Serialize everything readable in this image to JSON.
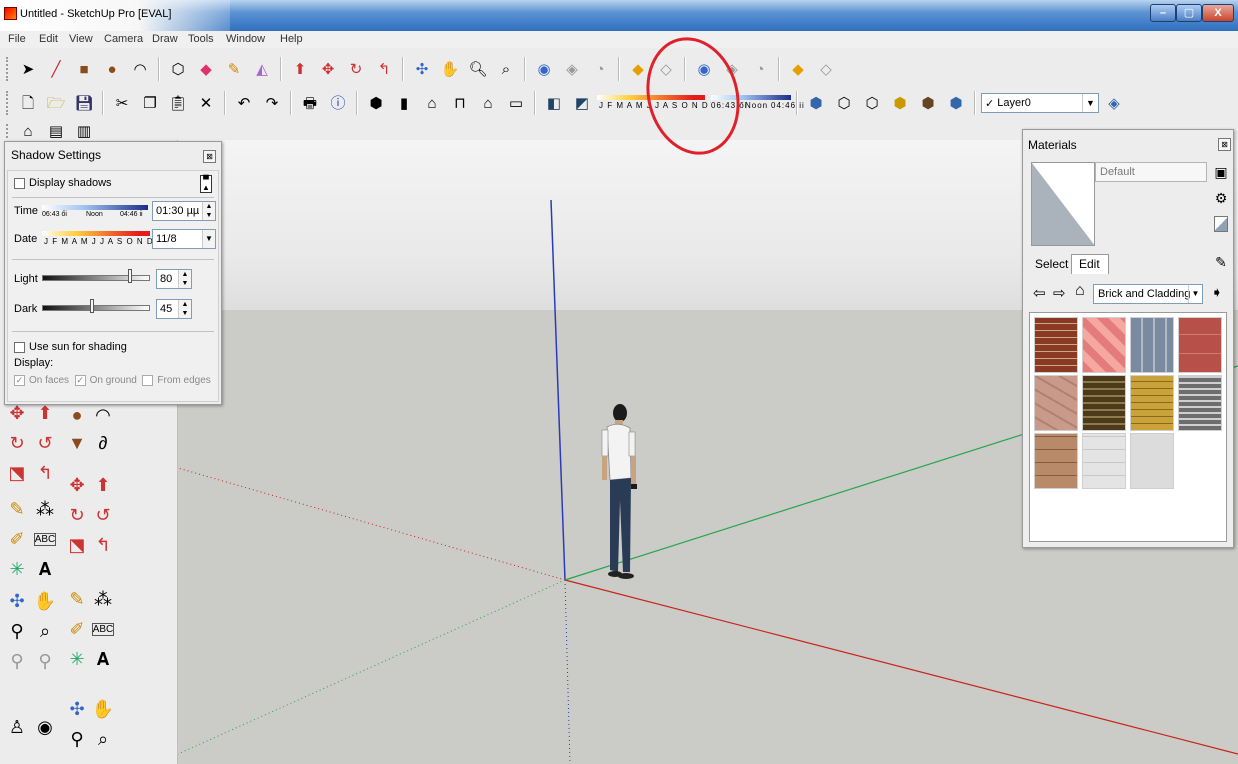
{
  "window": {
    "title": "Untitled - SketchUp Pro [EVAL]",
    "min_label": "–",
    "max_label": "▢",
    "close_label": "X"
  },
  "menu": [
    "File",
    "Edit",
    "View",
    "Camera",
    "Draw",
    "Tools",
    "Window",
    "Help"
  ],
  "toolbar": {
    "month_letters": "J F M A M J J A S O N D",
    "time_start": "06:43 ői",
    "time_noon": "Noon",
    "time_end": "04:46 ii",
    "layer": {
      "check": "✓",
      "name": "Layer0"
    }
  },
  "shadow_settings": {
    "title": "Shadow Settings",
    "close": "⊠",
    "display_shadows": "Display shadows",
    "time_label": "Time",
    "time_start": "06:43 ői",
    "time_noon": "Noon",
    "time_end": "04:46 ii",
    "time_value": "01:30 µµ",
    "date_label": "Date",
    "month_letters": "J F M A M J J A S O N D",
    "date_value": "11/8",
    "light_label": "Light",
    "light_value": "80",
    "dark_label": "Dark",
    "dark_value": "45",
    "use_sun": "Use sun for shading",
    "display_label": "Display:",
    "on_faces": "On faces",
    "on_ground": "On ground",
    "from_edges": "From edges"
  },
  "materials": {
    "title": "Materials",
    "close": "⊠",
    "name_value": "Default",
    "tab_select": "Select",
    "tab_edit": "Edit",
    "collection": "Brick and Cladding"
  },
  "colors": {
    "accent_annotation": "#e0202a",
    "blue_axis": "#2a3bb8",
    "red_axis": "#c8231c",
    "green_axis": "#25a64c"
  }
}
